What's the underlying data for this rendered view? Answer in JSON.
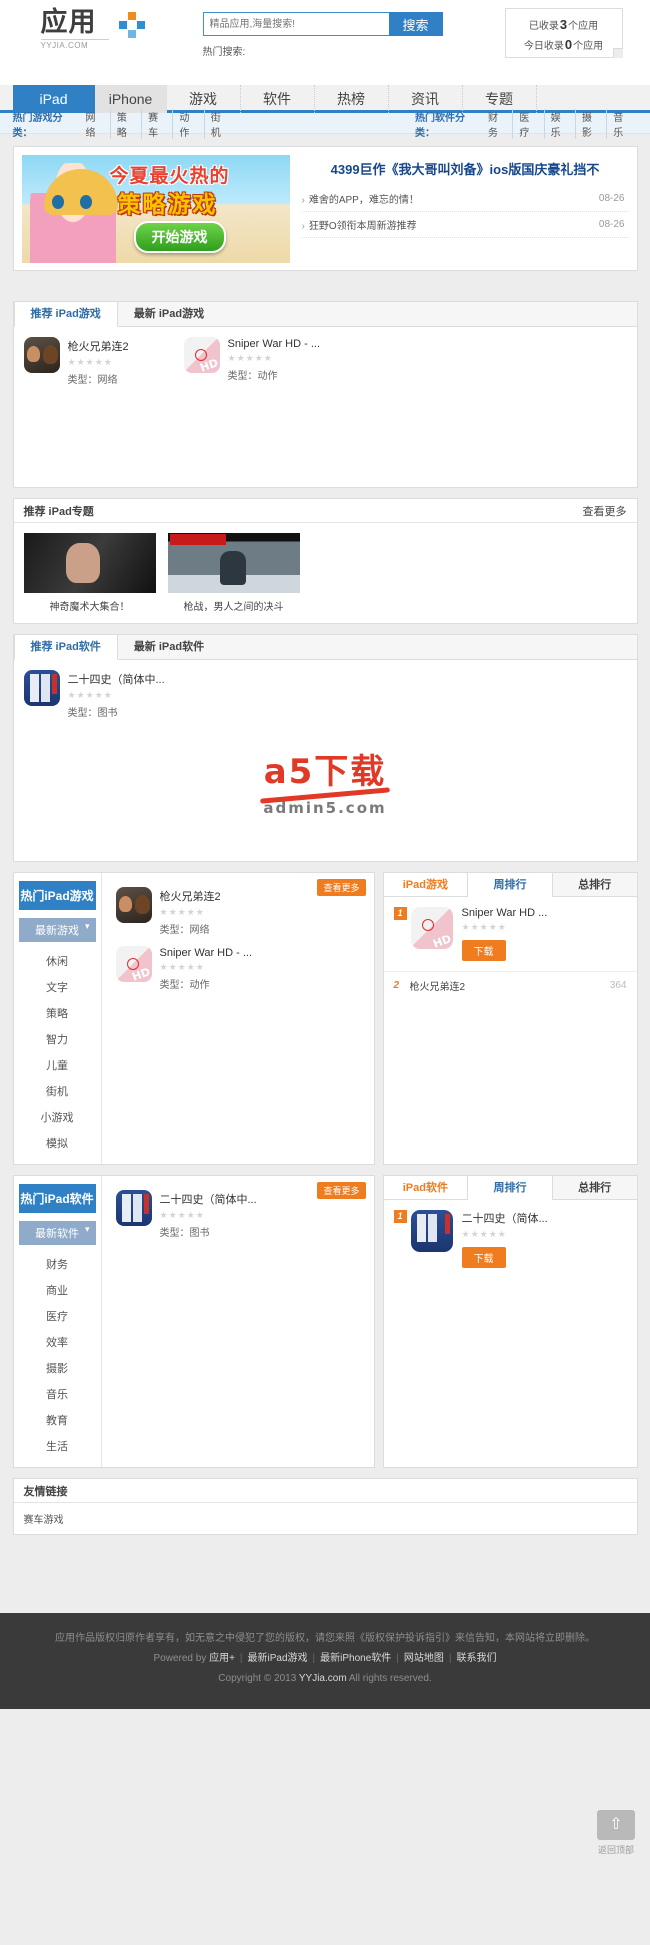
{
  "header": {
    "logo_word": "应用",
    "logo_sub": "YYJIA.COM",
    "search_placeholder": "精品应用,海量搜索!",
    "search_value": "",
    "search_button": "搜索",
    "hot_search_label": "热门搜索:",
    "stats_line1_pre": "已收录",
    "stats_line1_num": "3",
    "stats_line1_post": "个应用",
    "stats_line2_pre": "今日收录",
    "stats_line2_num": "0",
    "stats_line2_post": "个应用"
  },
  "nav": {
    "items": [
      {
        "label": "iPad",
        "style": "primary"
      },
      {
        "label": "iPhone",
        "style": "secondary"
      },
      {
        "label": "游戏",
        "style": "plain"
      },
      {
        "label": "软件",
        "style": "plain"
      },
      {
        "label": "热榜",
        "style": "plain"
      },
      {
        "label": "资讯",
        "style": "plain"
      },
      {
        "label": "专题",
        "style": "plain"
      }
    ]
  },
  "subnav": {
    "games_title": "热门游戏分类：",
    "games_links": [
      "网络",
      "策略",
      "赛车",
      "动作",
      "街机"
    ],
    "software_title": "热门软件分类：",
    "software_links": [
      "财务",
      "医疗",
      "娱乐",
      "摄影",
      "音乐"
    ]
  },
  "banner": {
    "image_title": "今夏最火热的",
    "image_title2": "策略游戏",
    "image_button": "开始游戏",
    "news_title": "4399巨作《我大哥叫刘备》ios版国庆豪礼挡不",
    "news": [
      {
        "text": "难舍的APP，难忘的情！",
        "date": "08-26"
      },
      {
        "text": "狂野O领衔本周新游推荐",
        "date": "08-26"
      }
    ]
  },
  "games_panel": {
    "tabs": [
      {
        "label": "推荐 iPad游戏",
        "active": true
      },
      {
        "label": "最新 iPad游戏",
        "active": false
      }
    ],
    "apps": [
      {
        "name": "枪火兄弟连2",
        "cat_label": "类型：",
        "cat": "网络",
        "icon": "gun-icon",
        "stars": "★★★★★"
      },
      {
        "name": "Sniper War HD - ...",
        "cat_label": "类型：",
        "cat": "动作",
        "icon": "sniper-icon",
        "stars": "★★★★★"
      }
    ]
  },
  "zhuanti": {
    "title": "推荐 iPad专题",
    "more": "查看更多",
    "items": [
      {
        "caption": "神奇魔术大集合！",
        "art": "a"
      },
      {
        "caption": "枪战，男人之间的决斗",
        "art": "b"
      }
    ]
  },
  "software_panel": {
    "tabs": [
      {
        "label": "推荐 iPad软件",
        "active": true
      },
      {
        "label": "最新 iPad软件",
        "active": false
      }
    ],
    "apps": [
      {
        "name": "二十四史（简体中...",
        "cat_label": "类型：",
        "cat": "图书",
        "icon": "book-icon",
        "stars": "★★★★★"
      }
    ]
  },
  "watermark": {
    "logo_a": "a",
    "logo_text": "5下载",
    "logo_sub": "admin5.com"
  },
  "hot_games_module": {
    "side_title": "热门iPad游戏",
    "side_selected": "最新游戏",
    "side_items": [
      "休闲",
      "文字",
      "策略",
      "智力",
      "儿童",
      "街机",
      "小游戏",
      "模拟"
    ],
    "more": "查看更多",
    "apps": [
      {
        "name": "枪火兄弟连2",
        "cat_label": "类型：",
        "cat": "网络",
        "icon": "gun-icon",
        "stars": "★★★★★"
      },
      {
        "name": "Sniper War HD - ...",
        "cat_label": "类型：",
        "cat": "动作",
        "icon": "sniper-icon",
        "stars": "★★★★★"
      }
    ],
    "rank": {
      "tabs": [
        {
          "label": "iPad游戏",
          "style": "orange"
        },
        {
          "label": "周排行",
          "style": "active"
        },
        {
          "label": "总排行",
          "style": "plain"
        }
      ],
      "top": {
        "no": "1",
        "name": "Sniper War HD ...",
        "stars": "★★★★★",
        "download": "下载",
        "icon": "sniper-icon"
      },
      "list": [
        {
          "no": "2",
          "name": "枪火兄弟连2",
          "count": "364"
        }
      ]
    }
  },
  "hot_software_module": {
    "side_title": "热门iPad软件",
    "side_selected": "最新软件",
    "side_items": [
      "财务",
      "商业",
      "医疗",
      "效率",
      "摄影",
      "音乐",
      "教育",
      "生活"
    ],
    "more": "查看更多",
    "apps": [
      {
        "name": "二十四史（简体中...",
        "cat_label": "类型：",
        "cat": "图书",
        "icon": "book-icon",
        "stars": "★★★★★"
      }
    ],
    "rank": {
      "tabs": [
        {
          "label": "iPad软件",
          "style": "orange"
        },
        {
          "label": "周排行",
          "style": "active"
        },
        {
          "label": "总排行",
          "style": "plain"
        }
      ],
      "top": {
        "no": "1",
        "name": "二十四史（简体...",
        "stars": "★★★★★",
        "download": "下载",
        "icon": "book-icon"
      },
      "list": []
    }
  },
  "friend_links": {
    "title": "友情链接",
    "items": [
      "赛车游戏"
    ]
  },
  "top_button": {
    "icon": "arrow-up-icon",
    "label": "返回顶部"
  },
  "footer": {
    "disclaimer": "应用作品版权归原作者享有，如无意之中侵犯了您的版权，请您来照《版权保护投诉指引》来信告知，本网站将立即删除。",
    "powered_by": "Powered by",
    "links": [
      "应用+",
      "最新iPad游戏",
      "最新iPhone软件",
      "网站地图",
      "联系我们"
    ],
    "copyright_pre": "Copyright © 2013",
    "copyright_site": "YYJia.com",
    "copyright_post": "All rights reserved."
  },
  "colors": {
    "brand_blue": "#2f80c4",
    "accent_orange": "#f07c20",
    "nav_bg": "#f1f1f1",
    "page_bg": "#ededed"
  }
}
